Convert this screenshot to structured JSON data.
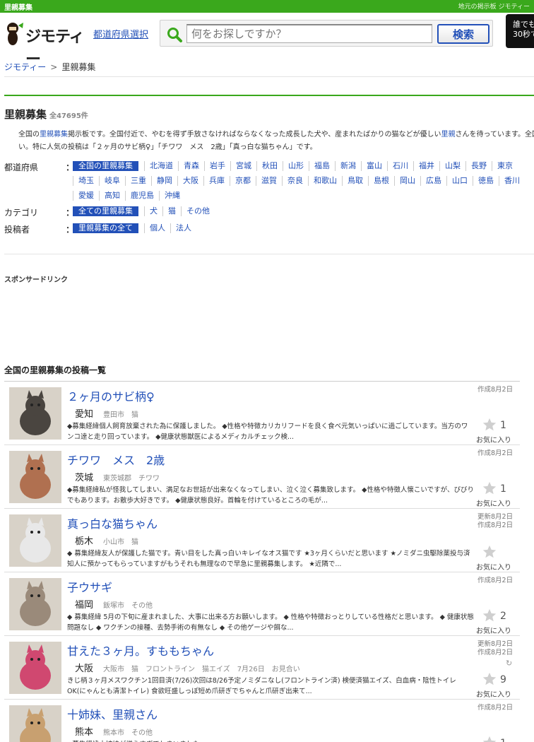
{
  "topbar": {
    "left": "里親募集",
    "right": "地元の掲示板 ジモティー"
  },
  "header": {
    "logo": "ジモティー",
    "pref_link": "都道府県選択",
    "search_placeholder": "何をお探しですか？",
    "search_button": "検索",
    "promo_line1": "誰でも",
    "promo_line2": "30秒で"
  },
  "breadcrumb": {
    "home": "ジモティー",
    "sep": ">",
    "current": "里親募集"
  },
  "page": {
    "title": "里親募集",
    "count": "全47695件",
    "intro_a": "全国の",
    "intro_link1": "里親募集",
    "intro_b": "掲示板です。全国付近で、やむを得ず手放さなければならなくなった成長した犬や、産まれたばかりの猫などが優しい",
    "intro_link2": "里親",
    "intro_c": "さんを待っています。全国",
    "intro_line2": "い。特に人気の投稿は「２ヶ月のサビ柄♀」「チワワ　メス　2歳」「真っ白な猫ちゃん」です。"
  },
  "filters": {
    "colon": "：",
    "pref_label": "都道府県",
    "pref_selected": "全国の里親募集",
    "prefectures": [
      "北海道",
      "青森",
      "岩手",
      "宮城",
      "秋田",
      "山形",
      "福島",
      "新潟",
      "富山",
      "石川",
      "福井",
      "山梨",
      "長野",
      "東京",
      "埼玉",
      "岐阜",
      "三重",
      "静岡",
      "大阪",
      "兵庫",
      "京都",
      "滋賀",
      "奈良",
      "和歌山",
      "鳥取",
      "島根",
      "岡山",
      "広島",
      "山口",
      "徳島",
      "香川",
      "愛媛",
      "高知",
      "鹿児島",
      "沖縄"
    ],
    "cat_label": "カテゴリ",
    "cat_selected": "全ての里親募集",
    "categories": [
      "犬",
      "猫",
      "その他"
    ],
    "poster_label": "投稿者",
    "poster_selected": "里親募集の全て",
    "posters": [
      "個人",
      "法人"
    ]
  },
  "sponsor": "スポンサードリンク",
  "list_title": "全国の里親募集の投稿一覧",
  "fav_label": "お気に入り",
  "listings": [
    {
      "title": "２ヶ月のサビ柄♀",
      "pref": "愛知",
      "sub": "豊田市　猫",
      "desc": "◆募集経緯個人飼育放棄された為に保護しました。 ◆性格や特徴カリカリフードを良く食べ元気いっぱいに過ごしています。当方のワンコ達と走り回っています。 ◆健康状態獣医によるメディカルチェック検...",
      "date1": "作成8月2日",
      "date2": "",
      "favs": "1",
      "color": "#4a4540"
    },
    {
      "title": "チワワ　メス　2歳",
      "pref": "茨城",
      "sub": "東茨城郡　チワワ",
      "desc": "◆募集経緯私が怪我してしまい、満足なお世話が出来なくなってしまい、泣く泣く募集致します。 ◆性格や特徴人懐こいですが、びびりでもあります。お散歩大好きです。 ◆健康状態良好。首輪を付けているところの毛が...",
      "date1": "作成8月2日",
      "date2": "",
      "favs": "1",
      "color": "#b07050"
    },
    {
      "title": "真っ白な猫ちゃん",
      "pref": "栃木",
      "sub": "小山市　猫",
      "desc": "◆ 募集経緯友人が保護した猫です。青い目をした真っ白いキレイなオス猫です ★3ヶ月くらいだと思います ★ノミダニ虫駆除薬投与済知人に預かってもらっていますがもうそれも無理なので早急に里親募集します。 ★近隣で...",
      "date1": "更新8月2日",
      "date2": "作成8月2日",
      "favs": "",
      "color": "#e8e8e8"
    },
    {
      "title": "子ウサギ",
      "pref": "福岡",
      "sub": "飯塚市　その他",
      "desc": "◆ 募集経緯 5月の下旬に産まれました、大事に出来る方お願いします。 ◆ 性格や特徴おっとりしている性格だと思います。 ◆ 健康状態問題なし ◆ ワクチンの接種、去勢手術の有無なし ◆ その他ゲージや餌な...",
      "date1": "作成8月2日",
      "date2": "",
      "favs": "2",
      "color": "#9a8a7a"
    },
    {
      "title": "甘えた３ヶ月。すももちゃん",
      "pref": "大阪",
      "sub": "大阪市　猫　フロントライン　猫エイズ　7月26日　お見合い",
      "desc": "きじ柄３ヶ月メスワクチン1回目済(7/26)次回は8/26予定ノミダニなし(フロントライン済) 検便済猫エイズ、白血病・陰性トイレOK(にゃんとも清潔トイレ) 食欲旺盛しっぽ短め爪研ぎでちゃんと爪研ぎ出来て...",
      "date1": "更新8月2日",
      "date2": "作成8月2日",
      "favs": "9",
      "color": "#d04870"
    },
    {
      "title": "十姉妹、里親さん",
      "pref": "熊本",
      "sub": "熊本市　その他",
      "desc": "◆募集経緯十姉妹が増えすぎてしまいました。",
      "date1": "作成8月2日",
      "date2": "",
      "favs": "1",
      "color": "#c8a070"
    }
  ]
}
